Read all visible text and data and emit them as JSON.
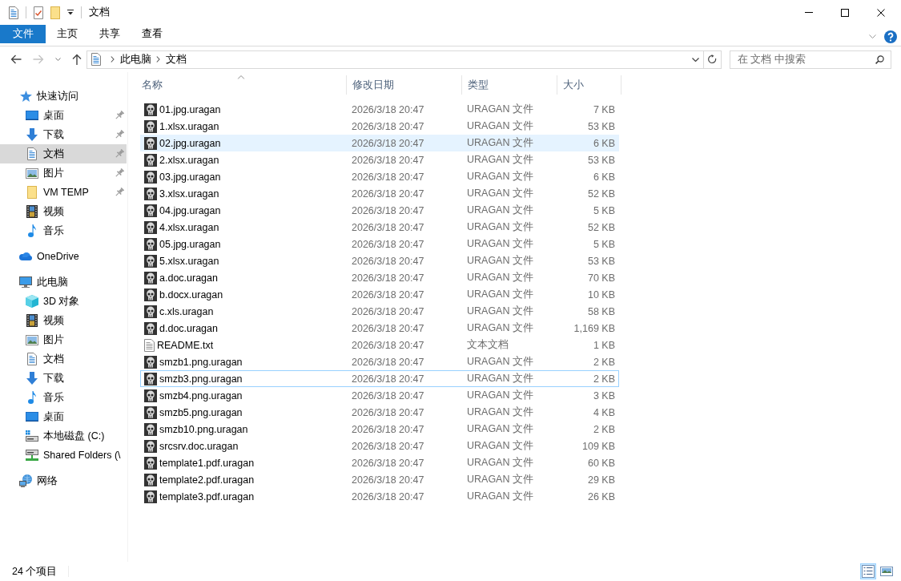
{
  "window": {
    "title": "文档"
  },
  "ribbon": {
    "file_tab": "文件",
    "tabs": [
      "主页",
      "共享",
      "查看"
    ]
  },
  "address_bar": {
    "path": [
      "此电脑",
      "文档"
    ]
  },
  "search": {
    "placeholder": "在 文档 中搜索"
  },
  "sidebar": {
    "items": [
      {
        "label": "快速访问",
        "kind": "quick-access",
        "selected": false,
        "pinned": false,
        "children": [
          {
            "label": "桌面",
            "kind": "desktop",
            "selected": false,
            "pinned": true
          },
          {
            "label": "下载",
            "kind": "downloads",
            "selected": false,
            "pinned": true
          },
          {
            "label": "文档",
            "kind": "documents",
            "selected": true,
            "pinned": true
          },
          {
            "label": "图片",
            "kind": "pictures",
            "selected": false,
            "pinned": true
          },
          {
            "label": "VM TEMP",
            "kind": "folder",
            "selected": false,
            "pinned": true
          },
          {
            "label": "视频",
            "kind": "videos",
            "selected": false,
            "pinned": false
          },
          {
            "label": "音乐",
            "kind": "music",
            "selected": false,
            "pinned": false
          }
        ]
      },
      {
        "label": "OneDrive",
        "kind": "onedrive",
        "selected": false,
        "pinned": false
      },
      {
        "label": "此电脑",
        "kind": "computer",
        "selected": false,
        "pinned": false,
        "children": [
          {
            "label": "3D 对象",
            "kind": "objects3d",
            "selected": false,
            "pinned": false
          },
          {
            "label": "视频",
            "kind": "videos",
            "selected": false,
            "pinned": false
          },
          {
            "label": "图片",
            "kind": "pictures",
            "selected": false,
            "pinned": false
          },
          {
            "label": "文档",
            "kind": "documents",
            "selected": false,
            "pinned": false
          },
          {
            "label": "下载",
            "kind": "downloads",
            "selected": false,
            "pinned": false
          },
          {
            "label": "音乐",
            "kind": "music",
            "selected": false,
            "pinned": false
          },
          {
            "label": "桌面",
            "kind": "desktop",
            "selected": false,
            "pinned": false
          },
          {
            "label": "本地磁盘 (C:)",
            "kind": "drive",
            "selected": false,
            "pinned": false
          },
          {
            "label": "Shared Folders (\\",
            "kind": "network-drive",
            "selected": false,
            "pinned": false
          }
        ]
      },
      {
        "label": "网络",
        "kind": "network",
        "selected": false,
        "pinned": false
      }
    ]
  },
  "file_list": {
    "columns": [
      {
        "label": "名称",
        "sorted": true
      },
      {
        "label": "修改日期",
        "sorted": false
      },
      {
        "label": "类型",
        "sorted": false
      },
      {
        "label": "大小",
        "sorted": false
      }
    ],
    "rows": [
      {
        "name": "01.jpg.uragan",
        "modified": "2026/3/18 20:47",
        "type": "URAGAN 文件",
        "size": "7 KB",
        "kind": "uragan",
        "hovered": false,
        "focused": false
      },
      {
        "name": "1.xlsx.uragan",
        "modified": "2026/3/18 20:47",
        "type": "URAGAN 文件",
        "size": "53 KB",
        "kind": "uragan",
        "hovered": false,
        "focused": false
      },
      {
        "name": "02.jpg.uragan",
        "modified": "2026/3/18 20:47",
        "type": "URAGAN 文件",
        "size": "6 KB",
        "kind": "uragan",
        "hovered": true,
        "focused": false
      },
      {
        "name": "2.xlsx.uragan",
        "modified": "2026/3/18 20:47",
        "type": "URAGAN 文件",
        "size": "53 KB",
        "kind": "uragan",
        "hovered": false,
        "focused": false
      },
      {
        "name": "03.jpg.uragan",
        "modified": "2026/3/18 20:47",
        "type": "URAGAN 文件",
        "size": "6 KB",
        "kind": "uragan",
        "hovered": false,
        "focused": false
      },
      {
        "name": "3.xlsx.uragan",
        "modified": "2026/3/18 20:47",
        "type": "URAGAN 文件",
        "size": "52 KB",
        "kind": "uragan",
        "hovered": false,
        "focused": false
      },
      {
        "name": "04.jpg.uragan",
        "modified": "2026/3/18 20:47",
        "type": "URAGAN 文件",
        "size": "5 KB",
        "kind": "uragan",
        "hovered": false,
        "focused": false
      },
      {
        "name": "4.xlsx.uragan",
        "modified": "2026/3/18 20:47",
        "type": "URAGAN 文件",
        "size": "52 KB",
        "kind": "uragan",
        "hovered": false,
        "focused": false
      },
      {
        "name": "05.jpg.uragan",
        "modified": "2026/3/18 20:47",
        "type": "URAGAN 文件",
        "size": "5 KB",
        "kind": "uragan",
        "hovered": false,
        "focused": false
      },
      {
        "name": "5.xlsx.uragan",
        "modified": "2026/3/18 20:47",
        "type": "URAGAN 文件",
        "size": "53 KB",
        "kind": "uragan",
        "hovered": false,
        "focused": false
      },
      {
        "name": "a.doc.uragan",
        "modified": "2026/3/18 20:47",
        "type": "URAGAN 文件",
        "size": "70 KB",
        "kind": "uragan",
        "hovered": false,
        "focused": false
      },
      {
        "name": "b.docx.uragan",
        "modified": "2026/3/18 20:47",
        "type": "URAGAN 文件",
        "size": "10 KB",
        "kind": "uragan",
        "hovered": false,
        "focused": false
      },
      {
        "name": "c.xls.uragan",
        "modified": "2026/3/18 20:47",
        "type": "URAGAN 文件",
        "size": "58 KB",
        "kind": "uragan",
        "hovered": false,
        "focused": false
      },
      {
        "name": "d.doc.uragan",
        "modified": "2026/3/18 20:47",
        "type": "URAGAN 文件",
        "size": "1,169 KB",
        "kind": "uragan",
        "hovered": false,
        "focused": false
      },
      {
        "name": "README.txt",
        "modified": "2026/3/18 20:47",
        "type": "文本文档",
        "size": "1 KB",
        "kind": "text",
        "hovered": false,
        "focused": false
      },
      {
        "name": "smzb1.png.uragan",
        "modified": "2026/3/18 20:47",
        "type": "URAGAN 文件",
        "size": "2 KB",
        "kind": "uragan",
        "hovered": false,
        "focused": false
      },
      {
        "name": "smzb3.png.uragan",
        "modified": "2026/3/18 20:47",
        "type": "URAGAN 文件",
        "size": "2 KB",
        "kind": "uragan",
        "hovered": false,
        "focused": true
      },
      {
        "name": "smzb4.png.uragan",
        "modified": "2026/3/18 20:47",
        "type": "URAGAN 文件",
        "size": "3 KB",
        "kind": "uragan",
        "hovered": false,
        "focused": false
      },
      {
        "name": "smzb5.png.uragan",
        "modified": "2026/3/18 20:47",
        "type": "URAGAN 文件",
        "size": "4 KB",
        "kind": "uragan",
        "hovered": false,
        "focused": false
      },
      {
        "name": "smzb10.png.uragan",
        "modified": "2026/3/18 20:47",
        "type": "URAGAN 文件",
        "size": "2 KB",
        "kind": "uragan",
        "hovered": false,
        "focused": false
      },
      {
        "name": "srcsrv.doc.uragan",
        "modified": "2026/3/18 20:47",
        "type": "URAGAN 文件",
        "size": "109 KB",
        "kind": "uragan",
        "hovered": false,
        "focused": false
      },
      {
        "name": "template1.pdf.uragan",
        "modified": "2026/3/18 20:47",
        "type": "URAGAN 文件",
        "size": "60 KB",
        "kind": "uragan",
        "hovered": false,
        "focused": false
      },
      {
        "name": "template2.pdf.uragan",
        "modified": "2026/3/18 20:47",
        "type": "URAGAN 文件",
        "size": "29 KB",
        "kind": "uragan",
        "hovered": false,
        "focused": false
      },
      {
        "name": "template3.pdf.uragan",
        "modified": "2026/3/18 20:47",
        "type": "URAGAN 文件",
        "size": "26 KB",
        "kind": "uragan",
        "hovered": false,
        "focused": false
      }
    ]
  },
  "status_bar": {
    "item_count": "24 个项目",
    "views": [
      {
        "kind": "details",
        "selected": true
      },
      {
        "kind": "tiles",
        "selected": false
      }
    ]
  }
}
